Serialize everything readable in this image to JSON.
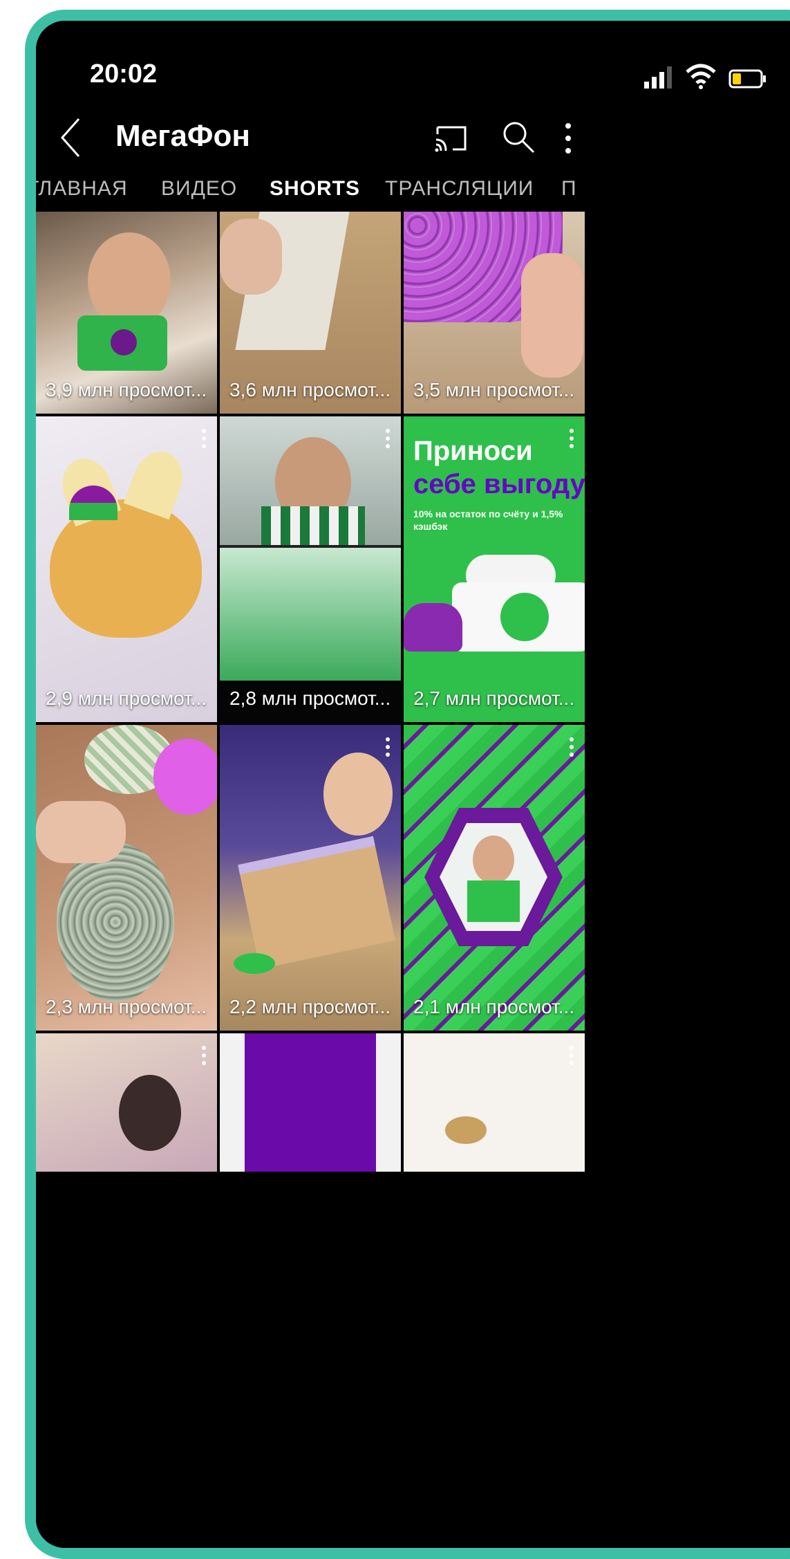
{
  "status": {
    "time": "20:02"
  },
  "appbar": {
    "channel": "МегаФон"
  },
  "tabs": [
    {
      "label": "ГЛАВНАЯ"
    },
    {
      "label": "ВИДЕО"
    },
    {
      "label": "SHORTS"
    },
    {
      "label": "ТРАНСЛЯЦИИ"
    },
    {
      "label": "П"
    }
  ],
  "active_tab": "SHORTS",
  "shorts": [
    {
      "views": "3,9 млн просмот..."
    },
    {
      "views": "3,6 млн просмот..."
    },
    {
      "views": "3,5 млн просмот..."
    },
    {
      "views": "2,9 млн просмот..."
    },
    {
      "views": "2,8 млн просмот..."
    },
    {
      "views": "2,7 млн просмот..."
    },
    {
      "views": "2,3 млн просмот..."
    },
    {
      "views": "2,2 млн просмот..."
    },
    {
      "views": "2,1 млн просмот..."
    }
  ],
  "promo": {
    "line1": "Приноси",
    "line2": "себе выгоду",
    "note": "10% на остаток по счёту и 1,5% кэшбэк"
  },
  "colors": {
    "accent_green": "#00b956",
    "accent_purple": "#731982",
    "frame": "#3dbfa6",
    "background": "#000000"
  }
}
